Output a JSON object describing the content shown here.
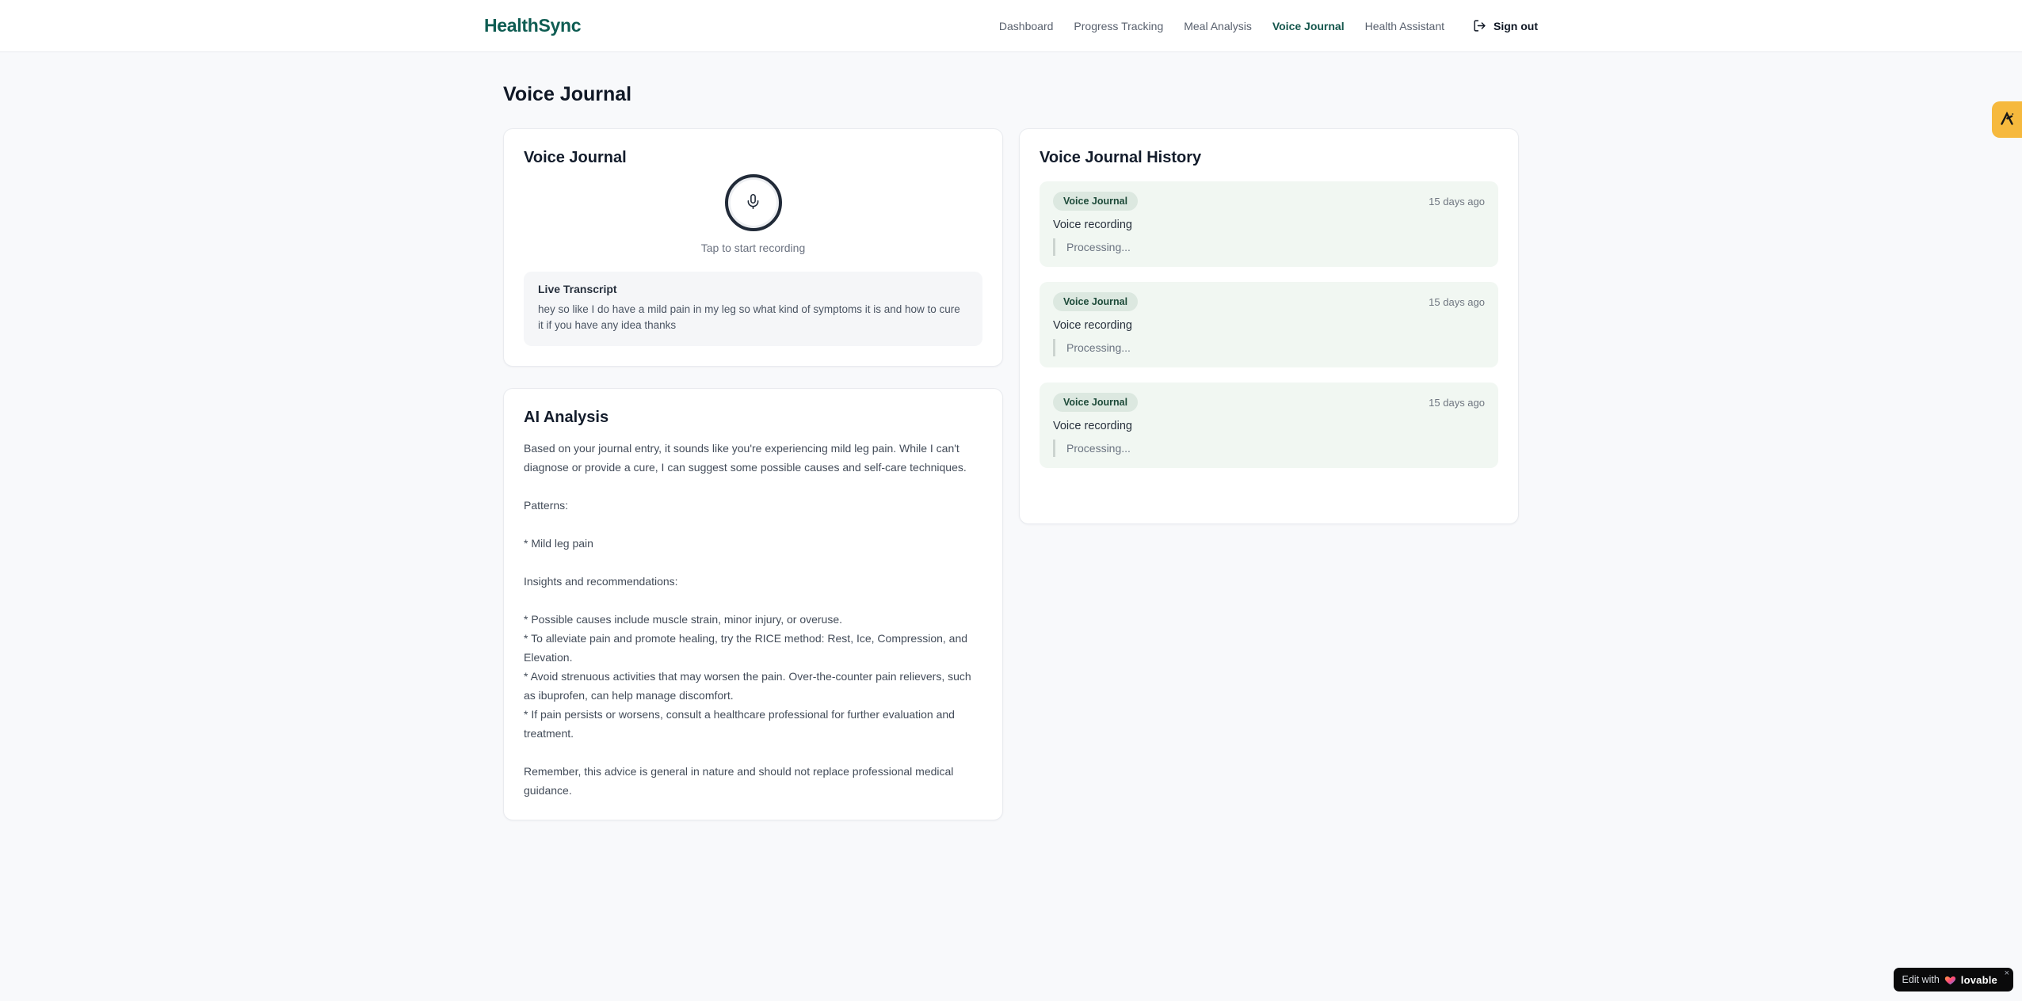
{
  "brand": {
    "name": "HealthSync"
  },
  "nav": {
    "items": [
      {
        "label": "Dashboard",
        "active": false
      },
      {
        "label": "Progress Tracking",
        "active": false
      },
      {
        "label": "Meal Analysis",
        "active": false
      },
      {
        "label": "Voice Journal",
        "active": true
      },
      {
        "label": "Health Assistant",
        "active": false
      }
    ],
    "sign_out_label": "Sign out"
  },
  "page": {
    "title": "Voice Journal"
  },
  "recorder_card": {
    "title": "Voice Journal",
    "tap_hint": "Tap to start recording",
    "live_transcript_label": "Live Transcript",
    "transcript": "hey so like I do have a mild pain in my leg so what kind of symptoms it is and how to cure it if you have any idea thanks"
  },
  "analysis_card": {
    "title": "AI Analysis",
    "body": "Based on your journal entry, it sounds like you're experiencing mild leg pain. While I can't diagnose or provide a cure, I can suggest some possible causes and self-care techniques.\n\nPatterns:\n\n* Mild leg pain\n\nInsights and recommendations:\n\n* Possible causes include muscle strain, minor injury, or overuse.\n* To alleviate pain and promote healing, try the RICE method: Rest, Ice, Compression, and Elevation.\n* Avoid strenuous activities that may worsen the pain. Over-the-counter pain relievers, such as ibuprofen, can help manage discomfort.\n* If pain persists or worsens, consult a healthcare professional for further evaluation and treatment.\n\nRemember, this advice is general in nature and should not replace professional medical guidance."
  },
  "history_card": {
    "title": "Voice Journal History",
    "entries": [
      {
        "badge": "Voice Journal",
        "time": "15 days ago",
        "title": "Voice recording",
        "status": "Processing..."
      },
      {
        "badge": "Voice Journal",
        "time": "15 days ago",
        "title": "Voice recording",
        "status": "Processing..."
      },
      {
        "badge": "Voice Journal",
        "time": "15 days ago",
        "title": "Voice recording",
        "status": "Processing..."
      }
    ]
  },
  "floating": {
    "edit_label": "Edit with",
    "brand_label": "lovable",
    "close_label": "×"
  },
  "colors": {
    "brand": "#0e5c52",
    "nav_active": "#14564c",
    "history_entry_bg": "#f1f7f2",
    "history_badge_bg": "#dce8e0",
    "history_badge_text": "#1d4a39",
    "fab_amber": "#f6b93d",
    "page_bg": "#f8f9fb"
  }
}
